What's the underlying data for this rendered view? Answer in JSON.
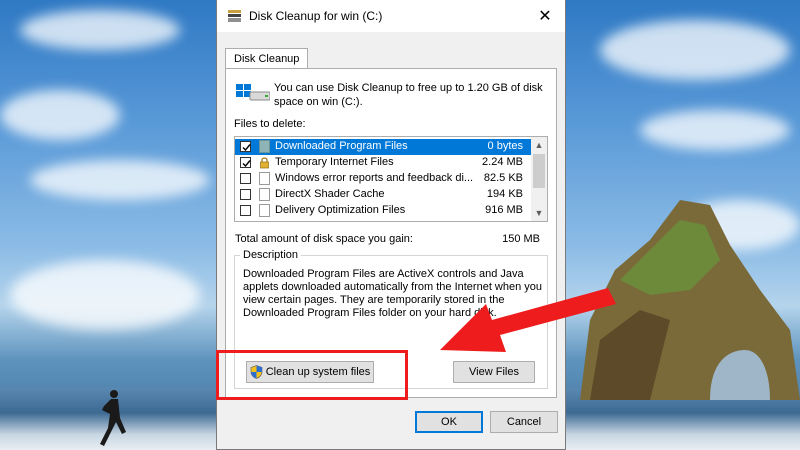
{
  "dialog": {
    "title": "Disk Cleanup for win (C:)",
    "tab": "Disk Cleanup",
    "intro": "You can use Disk Cleanup to free up to 1.20 GB of disk space on win (C:).",
    "files_label": "Files to delete:",
    "files": [
      {
        "name": "Downloaded Program Files",
        "size": "0 bytes",
        "checked": true,
        "selected": true,
        "icon": "teal-folder-icon"
      },
      {
        "name": "Temporary Internet Files",
        "size": "2.24 MB",
        "checked": true,
        "selected": false,
        "icon": "lock-icon"
      },
      {
        "name": "Windows error reports and feedback di...",
        "size": "82.5 KB",
        "checked": false,
        "selected": false,
        "icon": "file-icon"
      },
      {
        "name": "DirectX Shader Cache",
        "size": "194 KB",
        "checked": false,
        "selected": false,
        "icon": "file-icon"
      },
      {
        "name": "Delivery Optimization Files",
        "size": "916 MB",
        "checked": false,
        "selected": false,
        "icon": "file-icon"
      }
    ],
    "total_label": "Total amount of disk space you gain:",
    "total_value": "150 MB",
    "description_label": "Description",
    "description": "Downloaded Program Files are ActiveX controls and Java applets downloaded automatically from the Internet when you view certain pages. They are temporarily stored in the Downloaded Program Files folder on your hard disk.",
    "buttons": {
      "cleanup_system": "Clean up system files",
      "view_files": "View Files",
      "ok": "OK",
      "cancel": "Cancel"
    },
    "close_glyph": "✕"
  },
  "colors": {
    "selection": "#0078d7",
    "annotation_red": "#ee1c1c",
    "dialog_bg": "#f0f0f0"
  }
}
